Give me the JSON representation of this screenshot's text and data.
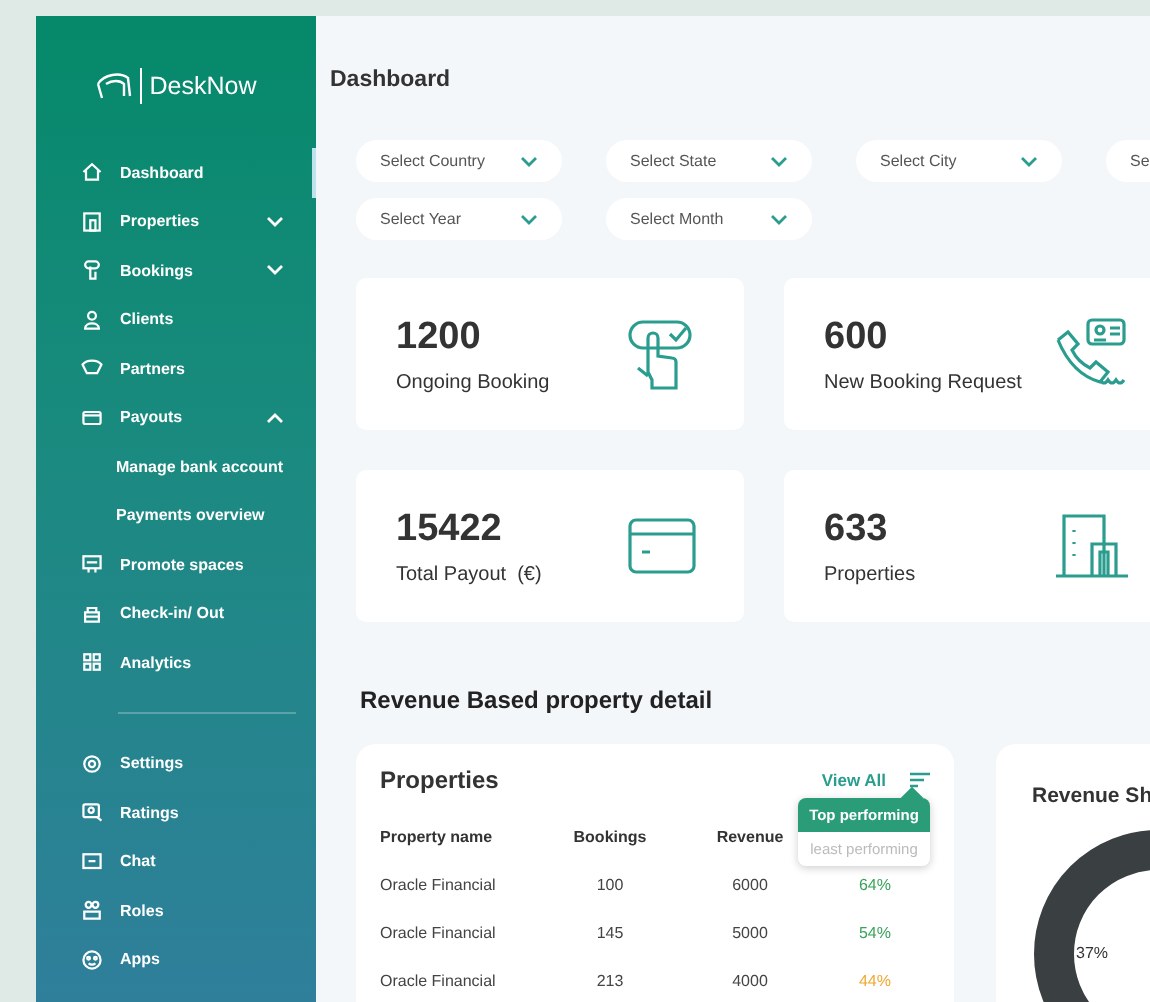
{
  "sidebar": {
    "logo": "DeskNow",
    "items": [
      {
        "label": "Dashboard",
        "selected": true
      },
      {
        "label": "Properties",
        "selected": false,
        "expanded": false
      },
      {
        "label": "Bookings",
        "selected": false,
        "expanded": false
      },
      {
        "label": "Clients",
        "selected": false
      },
      {
        "label": "Partners",
        "selected": false
      },
      {
        "label": "Payouts",
        "selected": false,
        "expanded": true,
        "children": [
          {
            "label": "Manage bank account"
          },
          {
            "label": "Payments overview"
          }
        ]
      },
      {
        "label": "Promote spaces",
        "selected": false
      },
      {
        "label": "Check-in/ Out",
        "selected": false
      },
      {
        "label": "Analytics",
        "selected": false
      }
    ],
    "bottom_items": [
      {
        "label": "Settings",
        "selected": false
      },
      {
        "label": "Ratings",
        "selected": false
      },
      {
        "label": "Chat",
        "selected": false
      },
      {
        "label": "Roles",
        "selected": false
      },
      {
        "label": "Apps",
        "selected": false
      }
    ]
  },
  "page_title": "Dashboard",
  "filter_rows": [
    {
      "items": [
        {
          "label": "Select Country"
        },
        {
          "label": "Select State"
        },
        {
          "label": "Select City"
        },
        {
          "label": "Se"
        }
      ]
    },
    {
      "items": [
        {
          "label": "Select Year"
        },
        {
          "label": "Select Month"
        }
      ]
    }
  ],
  "stat_cards": [
    {
      "value": "1200",
      "label": "Ongoing Booking"
    },
    {
      "value": "600",
      "label": "New Booking Request"
    },
    {
      "value": "15422",
      "label": "Total Payout  (€)"
    },
    {
      "value": "633",
      "label": "Properties"
    }
  ],
  "section_title": "Revenue Based property detail",
  "properties_card": {
    "title": "Properties",
    "view_all": "View All",
    "columns": [
      "Property name",
      "Bookings",
      "Revenue"
    ],
    "rows": [
      {
        "cells": [
          "Oracle Financial",
          "100",
          "6000",
          "64%"
        ],
        "color": "#3aa35a"
      },
      {
        "cells": [
          "Oracle Financial",
          "145",
          "5000",
          "54%"
        ],
        "color": "#3aa35a"
      },
      {
        "cells": [
          "Oracle Financial",
          "213",
          "4000",
          "44%"
        ],
        "color": "#f0a830"
      }
    ],
    "sort_menu": [
      {
        "label": "Top performing",
        "selected": true
      },
      {
        "label": "least performing",
        "selected": false
      }
    ]
  },
  "revenue_card": {
    "title": "Revenue Sh",
    "donut_label": "37%"
  }
}
